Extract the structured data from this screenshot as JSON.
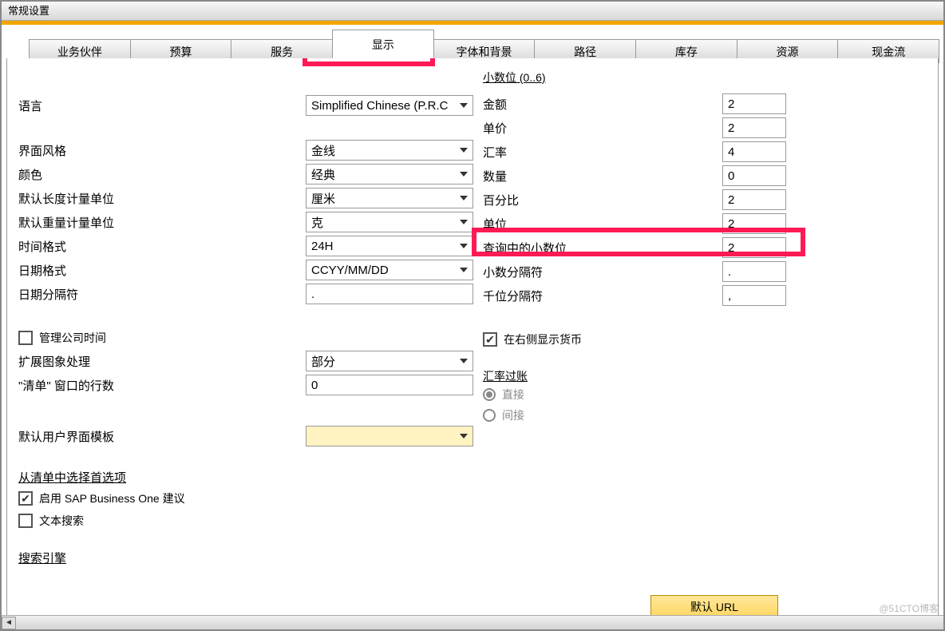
{
  "window": {
    "title": "常规设置"
  },
  "tabs": [
    "业务伙伴",
    "预算",
    "服务",
    "显示",
    "字体和背景",
    "路径",
    "库存",
    "资源",
    "现金流"
  ],
  "active_tab_index": 3,
  "left": {
    "language_label": "语言",
    "language_value": "Simplified Chinese (P.R.C",
    "skin_label": "界面风格",
    "skin_value": "金线",
    "color_label": "颜色",
    "color_value": "经典",
    "length_unit_label": "默认长度计量单位",
    "length_unit_value": "厘米",
    "weight_unit_label": "默认重量计量单位",
    "weight_unit_value": "克",
    "time_fmt_label": "时间格式",
    "time_fmt_value": "24H",
    "date_fmt_label": "日期格式",
    "date_fmt_value": "CCYY/MM/DD",
    "date_sep_label": "日期分隔符",
    "date_sep_value": ".",
    "manage_time_label": "管理公司时间",
    "image_proc_label": "扩展图象处理",
    "image_proc_value": "部分",
    "list_rows_label": "\"清单\" 窗口的行数",
    "list_rows_value": "0",
    "ui_template_label": "默认用户界面模板",
    "pref_header": "从清单中选择首选项",
    "sap_suggest_label": "启用 SAP Business One 建议",
    "text_search_label": "文本搜索",
    "search_engine_label": "搜索引擎"
  },
  "right": {
    "decimals_header": "小数位 (0..6)",
    "amount_label": "金额",
    "amount_value": "2",
    "price_label": "单价",
    "price_value": "2",
    "rate_label": "汇率",
    "rate_value": "4",
    "qty_label": "数量",
    "qty_value": "0",
    "percent_label": "百分比",
    "percent_value": "2",
    "unit_label": "单位",
    "unit_value": "2",
    "query_dec_label": "查询中的小数位",
    "query_dec_value": "2",
    "dec_sep_label": "小数分隔符",
    "dec_sep_value": ".",
    "thou_sep_label": "千位分隔符",
    "thou_sep_value": ",",
    "show_currency_right_label": "在右侧显示货币",
    "rate_posting_label": "汇率过账",
    "direct_label": "直接",
    "indirect_label": "间接"
  },
  "bottom_btn": "默认 URL",
  "watermark": "@51CTO博客"
}
